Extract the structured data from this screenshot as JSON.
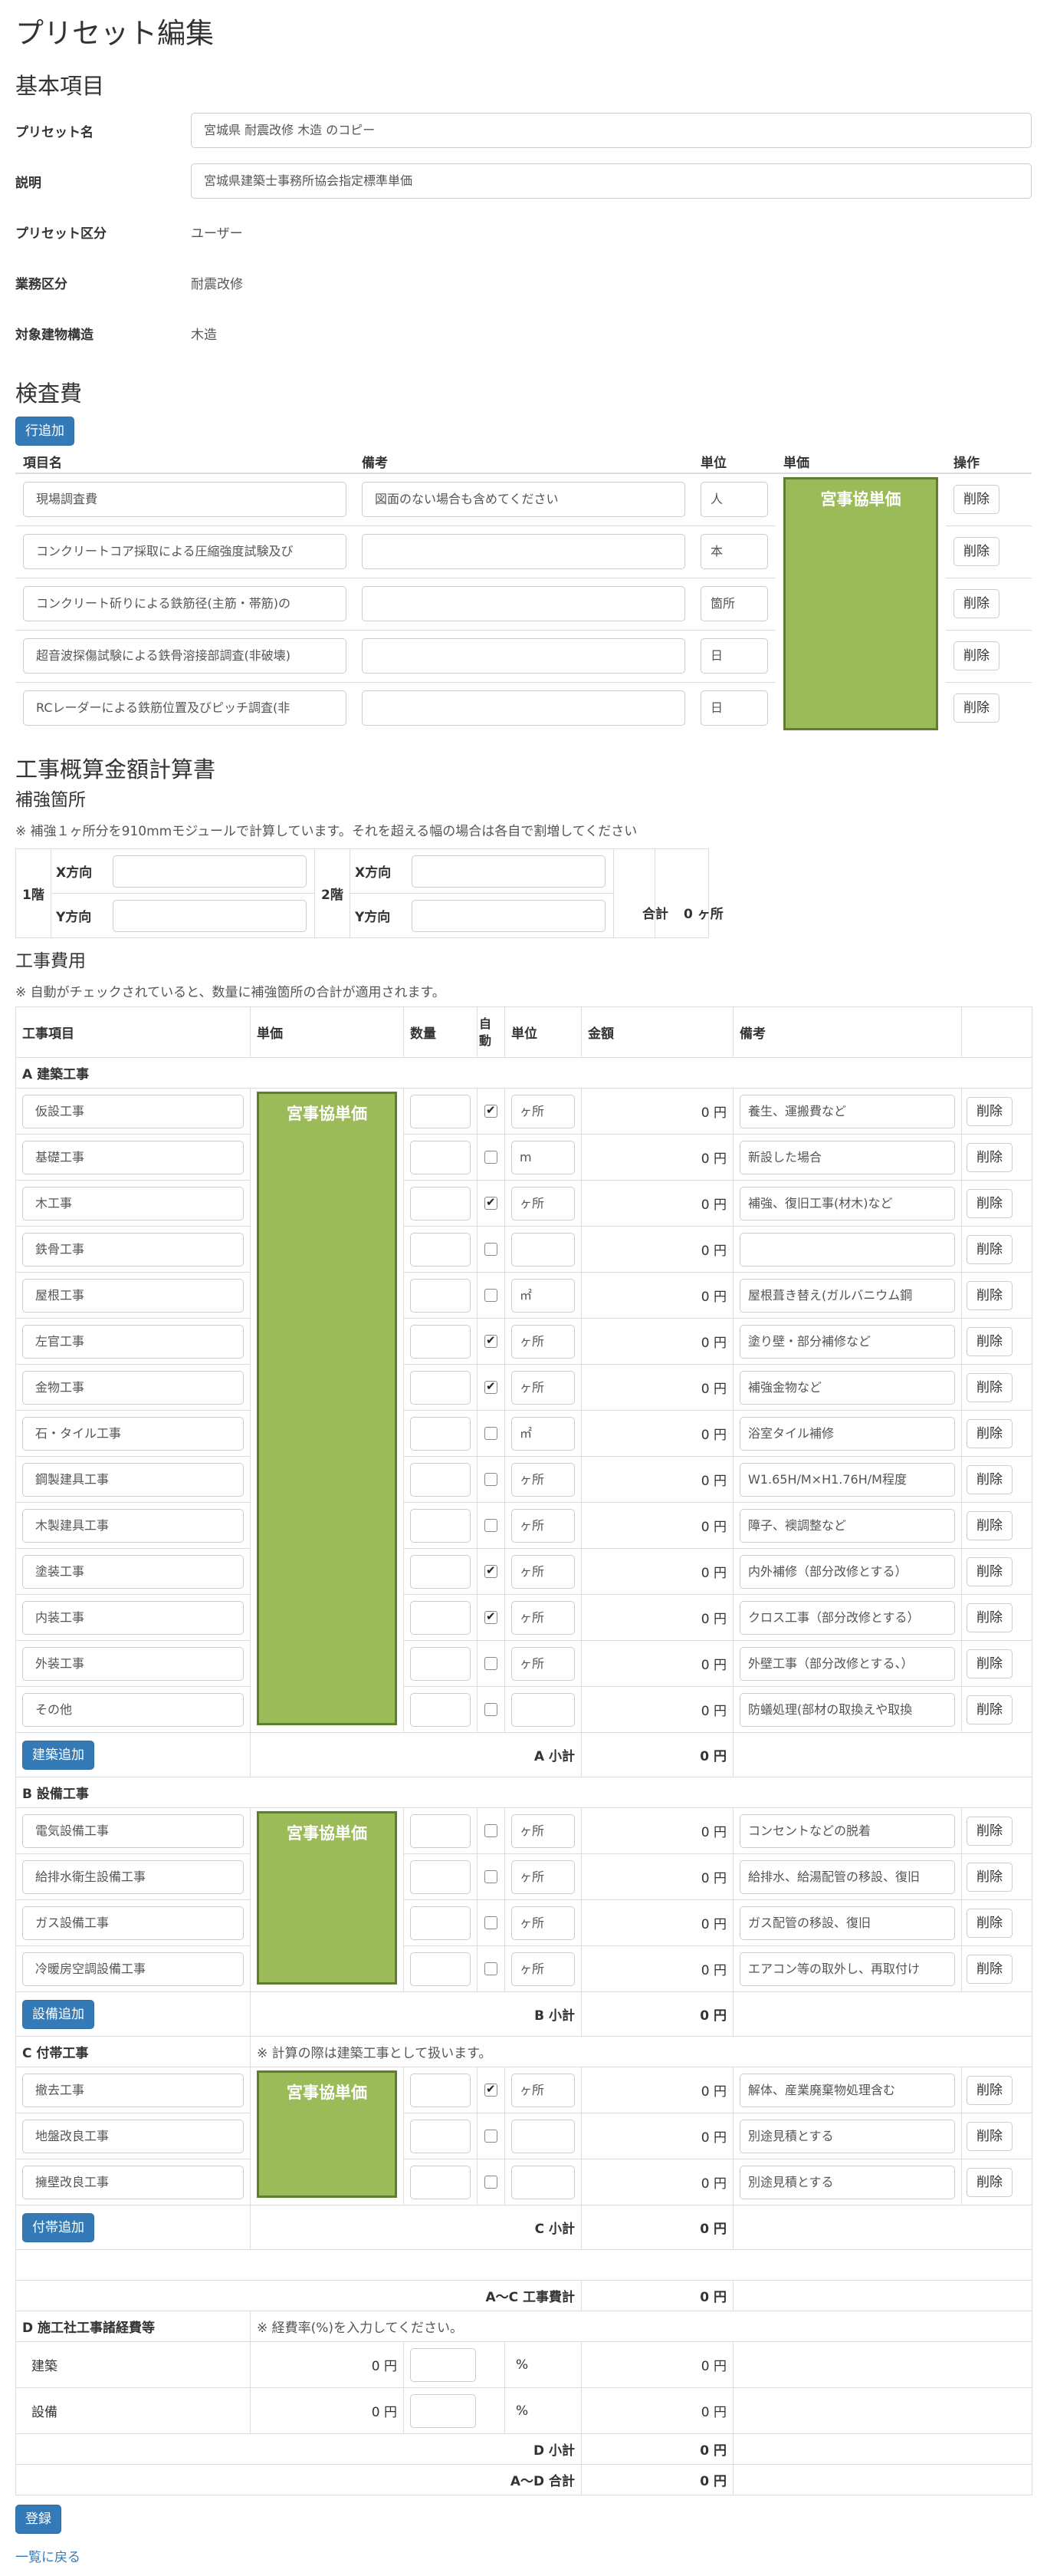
{
  "page_title": "プリセット編集",
  "basic": {
    "heading": "基本項目",
    "preset_name_label": "プリセット名",
    "preset_name_value": "宮城県 耐震改修 木造 のコピー",
    "description_label": "説明",
    "description_value": "宮城県建築士事務所協会指定標準単価",
    "category_label": "プリセット区分",
    "category_value": "ユーザー",
    "business_label": "業務区分",
    "business_value": "耐震改修",
    "structure_label": "対象建物構造",
    "structure_value": "木造"
  },
  "inspection": {
    "heading": "検査費",
    "add_row": "行追加",
    "col_item": "項目名",
    "col_note": "備考",
    "col_unit": "単位",
    "col_price": "単価",
    "col_ops": "操作",
    "price_box": "宮事協単価",
    "delete": "削除",
    "rows": [
      {
        "name": "現場調査費",
        "note": "図面のない場合も含めてください",
        "unit": "人"
      },
      {
        "name": "コンクリートコア採取による圧縮強度試験及び",
        "note": "",
        "unit": "本"
      },
      {
        "name": "コンクリート斫りによる鉄筋径(主筋・帯筋)の",
        "note": "",
        "unit": "箇所"
      },
      {
        "name": "超音波探傷試験による鉄骨溶接部調査(非破壊)",
        "note": "",
        "unit": "日"
      },
      {
        "name": "RCレーダーによる鉄筋位置及びピッチ調査(非",
        "note": "",
        "unit": "日"
      }
    ]
  },
  "estimate": {
    "heading": "工事概算金額計算書",
    "reinforce_heading": "補強箇所",
    "reinforce_note": "※ 補強１ヶ所分を910mmモジュールで計算しています。それを超える幅の場合は各自で割増してください",
    "floor1": "1階",
    "floor2": "2階",
    "x_dir": "X方向",
    "y_dir": "Y方向",
    "total_label": "合計",
    "total_value": "0 ヶ所",
    "cost_heading": "工事費用",
    "cost_note": "※ 自動がチェックされていると、数量に補強箇所の合計が適用されます。",
    "col_item": "工事項目",
    "col_price": "単価",
    "col_qty": "数量",
    "col_auto": "自動",
    "col_unit": "単位",
    "col_amount": "金額",
    "col_note": "備考",
    "price_box": "宮事協単価",
    "delete": "削除",
    "section_a": "A 建築工事",
    "a_rows": [
      {
        "name": "仮設工事",
        "auto": true,
        "unit": "ヶ所",
        "amount": "0 円",
        "note": "養生、運搬費など"
      },
      {
        "name": "基礎工事",
        "auto": false,
        "unit": "m",
        "amount": "0 円",
        "note": "新設した場合"
      },
      {
        "name": "木工事",
        "auto": true,
        "unit": "ヶ所",
        "amount": "0 円",
        "note": "補強、復旧工事(材木)など"
      },
      {
        "name": "鉄骨工事",
        "auto": false,
        "unit": "",
        "amount": "0 円",
        "note": ""
      },
      {
        "name": "屋根工事",
        "auto": false,
        "unit": "㎡",
        "amount": "0 円",
        "note": "屋根葺き替え(ガルバニウム鋼"
      },
      {
        "name": "左官工事",
        "auto": true,
        "unit": "ヶ所",
        "amount": "0 円",
        "note": "塗り壁・部分補修など"
      },
      {
        "name": "金物工事",
        "auto": true,
        "unit": "ヶ所",
        "amount": "0 円",
        "note": "補強金物など"
      },
      {
        "name": "石・タイル工事",
        "auto": false,
        "unit": "㎡",
        "amount": "0 円",
        "note": "浴室タイル補修"
      },
      {
        "name": "鋼製建具工事",
        "auto": false,
        "unit": "ヶ所",
        "amount": "0 円",
        "note": "W1.65H/M×H1.76H/M程度"
      },
      {
        "name": "木製建具工事",
        "auto": false,
        "unit": "ヶ所",
        "amount": "0 円",
        "note": "障子、襖調整など"
      },
      {
        "name": "塗装工事",
        "auto": true,
        "unit": "ヶ所",
        "amount": "0 円",
        "note": "内外補修（部分改修とする）"
      },
      {
        "name": "内装工事",
        "auto": true,
        "unit": "ヶ所",
        "amount": "0 円",
        "note": "クロス工事（部分改修とする）"
      },
      {
        "name": "外装工事",
        "auto": false,
        "unit": "ヶ所",
        "amount": "0 円",
        "note": "外壁工事（部分改修とする、）"
      },
      {
        "name": "その他",
        "auto": false,
        "unit": "",
        "amount": "0 円",
        "note": "防蟻処理(部材の取換えや取換"
      }
    ],
    "add_a": "建築追加",
    "subtotal_a_label": "A 小計",
    "subtotal_a": "0 円",
    "section_b": "B 設備工事",
    "b_rows": [
      {
        "name": "電気設備工事",
        "auto": false,
        "unit": "ヶ所",
        "amount": "0 円",
        "note": "コンセントなどの脱着"
      },
      {
        "name": "給排水衛生設備工事",
        "auto": false,
        "unit": "ヶ所",
        "amount": "0 円",
        "note": "給排水、給湯配管の移設、復旧"
      },
      {
        "name": "ガス設備工事",
        "auto": false,
        "unit": "ヶ所",
        "amount": "0 円",
        "note": "ガス配管の移設、復旧"
      },
      {
        "name": "冷暖房空調設備工事",
        "auto": false,
        "unit": "ヶ所",
        "amount": "0 円",
        "note": "エアコン等の取外し、再取付け"
      }
    ],
    "add_b": "設備追加",
    "subtotal_b_label": "B 小計",
    "subtotal_b": "0 円",
    "section_c": "C 付帯工事",
    "section_c_note": "※ 計算の際は建築工事として扱います。",
    "c_rows": [
      {
        "name": "撤去工事",
        "auto": true,
        "unit": "ヶ所",
        "amount": "0 円",
        "note": "解体、産業廃棄物処理含む"
      },
      {
        "name": "地盤改良工事",
        "auto": false,
        "unit": "",
        "amount": "0 円",
        "note": "別途見積とする"
      },
      {
        "name": "擁壁改良工事",
        "auto": false,
        "unit": "",
        "amount": "0 円",
        "note": "別途見積とする"
      }
    ],
    "add_c": "付帯追加",
    "subtotal_c_label": "C 小計",
    "subtotal_c": "0 円",
    "total_ac_label": "A〜C 工事費計",
    "total_ac": "0 円",
    "section_d": "D 施工社工事諸経費等",
    "section_d_note": "※ 経費率(%)を入力してください。",
    "d_rows": [
      {
        "name": "建築",
        "base": "0 円",
        "pct": "%",
        "amount": "0 円"
      },
      {
        "name": "設備",
        "base": "0 円",
        "pct": "%",
        "amount": "0 円"
      }
    ],
    "subtotal_d_label": "D 小計",
    "subtotal_d": "0 円",
    "total_ad_label": "A〜D 合計",
    "total_ad": "0 円"
  },
  "register": "登録",
  "back_link": "一覧に戻る"
}
